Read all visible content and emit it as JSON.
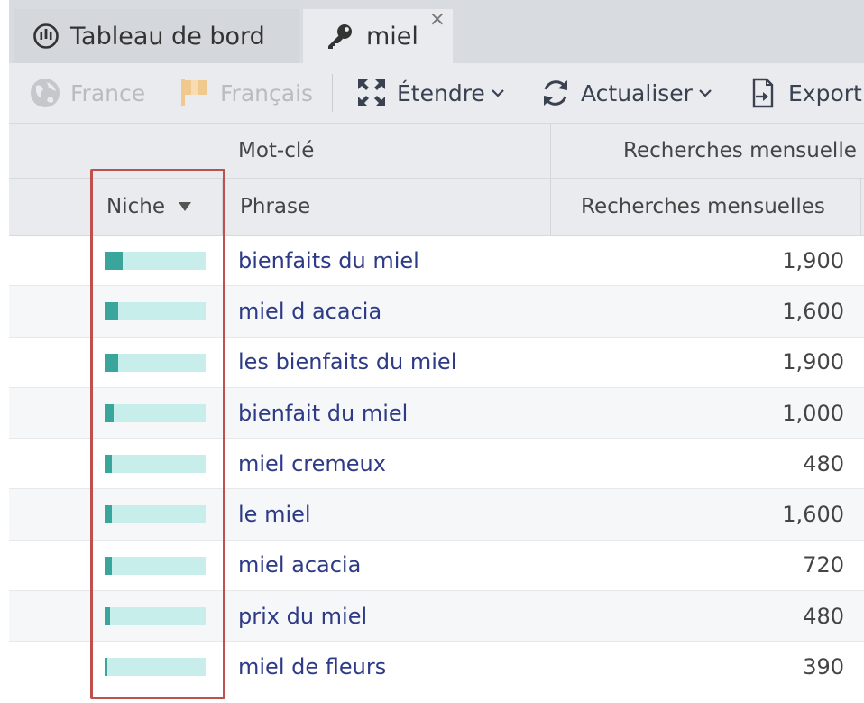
{
  "tabs": [
    {
      "label": "Tableau de bord",
      "icon": "dashboard-gauge-icon",
      "active": false
    },
    {
      "label": "miel",
      "icon": "key-icon",
      "active": true,
      "close": "×"
    }
  ],
  "toolbar": {
    "country": "France",
    "language": "Français",
    "expand": "Étendre",
    "refresh": "Actualiser",
    "export": "Export"
  },
  "table": {
    "group_headers": {
      "keyword": "Mot-clé",
      "searches": "Recherches mensuelle"
    },
    "columns": {
      "niche": "Niche",
      "phrase": "Phrase",
      "searches": "Recherches mensuelles"
    },
    "sort_icon": "sort-desc-icon",
    "rows": [
      {
        "phrase": "bienfaits du miel",
        "searches": "1,900",
        "niche": 0.18
      },
      {
        "phrase": "miel d acacia",
        "searches": "1,600",
        "niche": 0.13
      },
      {
        "phrase": "les bienfaits du miel",
        "searches": "1,900",
        "niche": 0.13
      },
      {
        "phrase": "bienfait du miel",
        "searches": "1,000",
        "niche": 0.09
      },
      {
        "phrase": "miel cremeux",
        "searches": "480",
        "niche": 0.07
      },
      {
        "phrase": "le miel",
        "searches": "1,600",
        "niche": 0.07
      },
      {
        "phrase": "miel acacia",
        "searches": "720",
        "niche": 0.07
      },
      {
        "phrase": "prix du miel",
        "searches": "480",
        "niche": 0.05
      },
      {
        "phrase": "miel de fleurs",
        "searches": "390",
        "niche": 0.03
      }
    ]
  },
  "colors": {
    "niche_fill": "#3aa59b",
    "niche_track": "#c7eeeb",
    "phrase_link": "#2d3a86",
    "highlight_border": "#c0504d"
  }
}
